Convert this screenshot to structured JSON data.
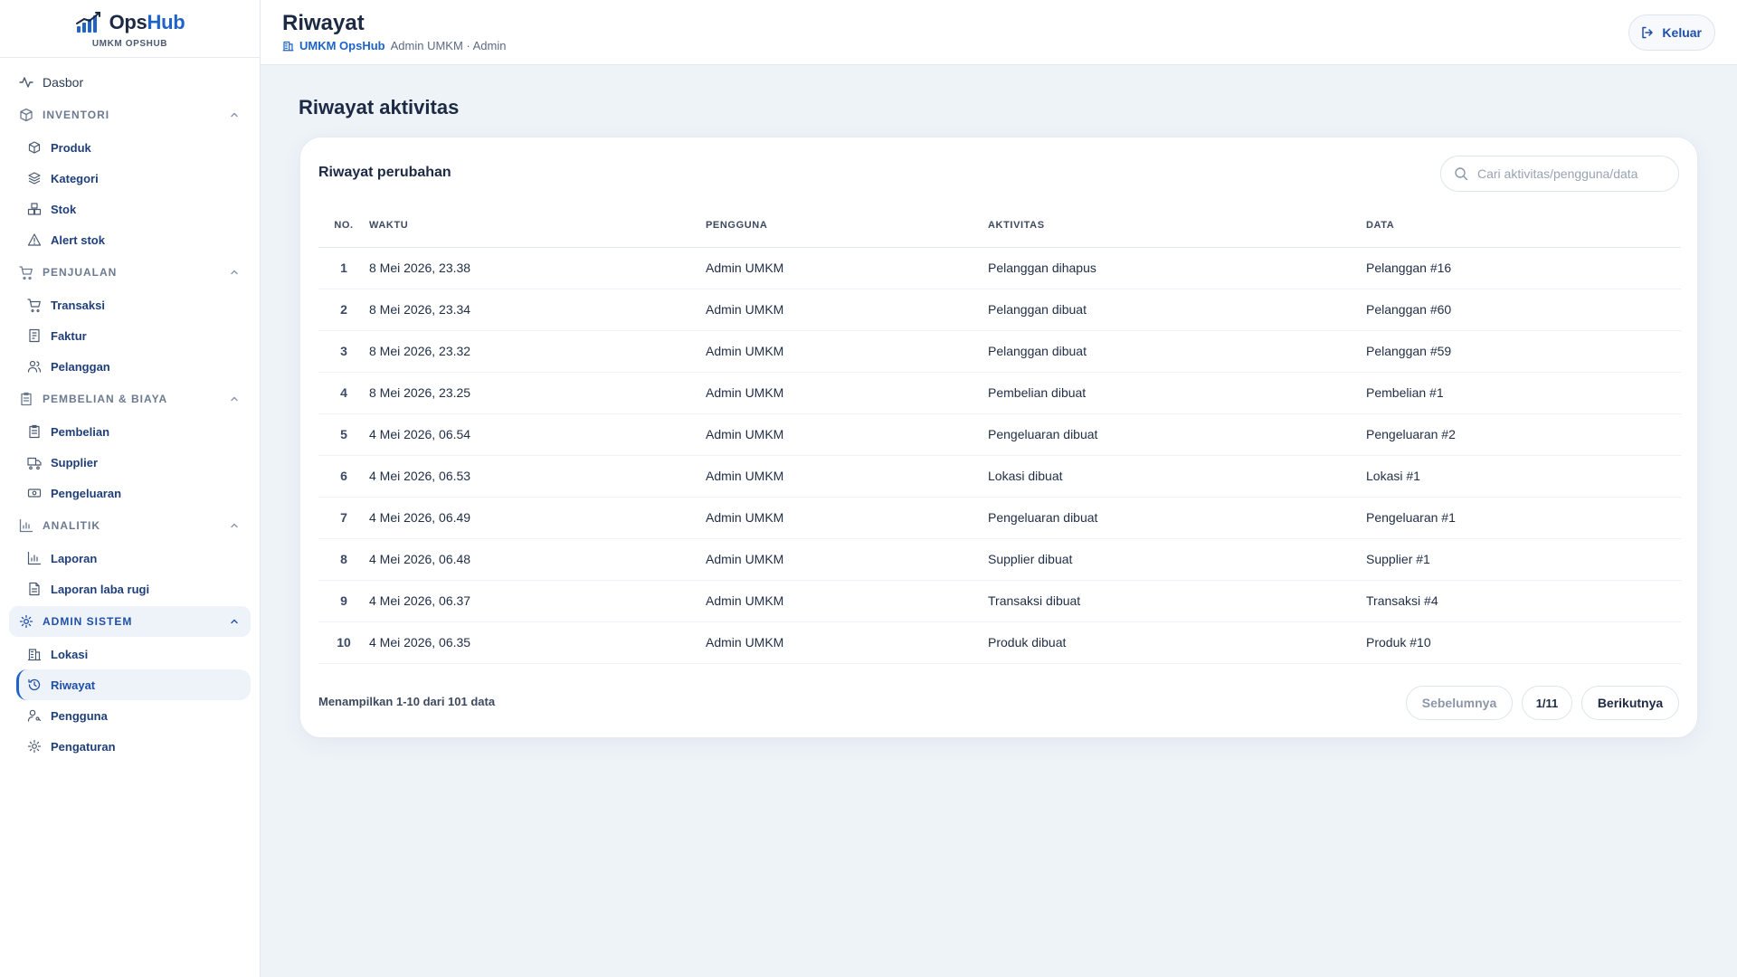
{
  "brand": {
    "name_part1": "Ops",
    "name_part2": "Hub",
    "subtitle": "UMKM OPSHUB"
  },
  "sidebar": {
    "dashboard": "Dasbor",
    "sections": [
      {
        "label": "INVENTORI",
        "items": [
          "Produk",
          "Kategori",
          "Stok",
          "Alert stok"
        ]
      },
      {
        "label": "PENJUALAN",
        "items": [
          "Transaksi",
          "Faktur",
          "Pelanggan"
        ]
      },
      {
        "label": "PEMBELIAN & BIAYA",
        "items": [
          "Pembelian",
          "Supplier",
          "Pengeluaran"
        ]
      },
      {
        "label": "ANALITIK",
        "items": [
          "Laporan",
          "Laporan laba rugi"
        ]
      },
      {
        "label": "ADMIN SISTEM",
        "items": [
          "Lokasi",
          "Riwayat",
          "Pengguna",
          "Pengaturan"
        ]
      }
    ]
  },
  "header": {
    "title": "Riwayat",
    "org": "UMKM OpsHub",
    "user": "Admin UMKM · Admin",
    "logout": "Keluar"
  },
  "main": {
    "heading": "Riwayat aktivitas",
    "card_title": "Riwayat perubahan",
    "search_placeholder": "Cari aktivitas/pengguna/data"
  },
  "table": {
    "columns": [
      "NO.",
      "WAKTU",
      "PENGGUNA",
      "AKTIVITAS",
      "DATA"
    ],
    "rows": [
      [
        "1",
        "8 Mei 2026, 23.38",
        "Admin UMKM",
        "Pelanggan dihapus",
        "Pelanggan #16"
      ],
      [
        "2",
        "8 Mei 2026, 23.34",
        "Admin UMKM",
        "Pelanggan dibuat",
        "Pelanggan #60"
      ],
      [
        "3",
        "8 Mei 2026, 23.32",
        "Admin UMKM",
        "Pelanggan dibuat",
        "Pelanggan #59"
      ],
      [
        "4",
        "8 Mei 2026, 23.25",
        "Admin UMKM",
        "Pembelian dibuat",
        "Pembelian #1"
      ],
      [
        "5",
        "4 Mei 2026, 06.54",
        "Admin UMKM",
        "Pengeluaran dibuat",
        "Pengeluaran #2"
      ],
      [
        "6",
        "4 Mei 2026, 06.53",
        "Admin UMKM",
        "Lokasi dibuat",
        "Lokasi #1"
      ],
      [
        "7",
        "4 Mei 2026, 06.49",
        "Admin UMKM",
        "Pengeluaran dibuat",
        "Pengeluaran #1"
      ],
      [
        "8",
        "4 Mei 2026, 06.48",
        "Admin UMKM",
        "Supplier dibuat",
        "Supplier #1"
      ],
      [
        "9",
        "4 Mei 2026, 06.37",
        "Admin UMKM",
        "Transaksi dibuat",
        "Transaksi #4"
      ],
      [
        "10",
        "4 Mei 2026, 06.35",
        "Admin UMKM",
        "Produk dibuat",
        "Produk #10"
      ]
    ]
  },
  "pagination": {
    "info": "Menampilkan 1-10 dari 101 data",
    "prev": "Sebelumnya",
    "current": "1/11",
    "next": "Berikutnya"
  },
  "colors": {
    "accent": "#1f63c9",
    "text": "#1c2a44",
    "background": "#eef3f8"
  }
}
